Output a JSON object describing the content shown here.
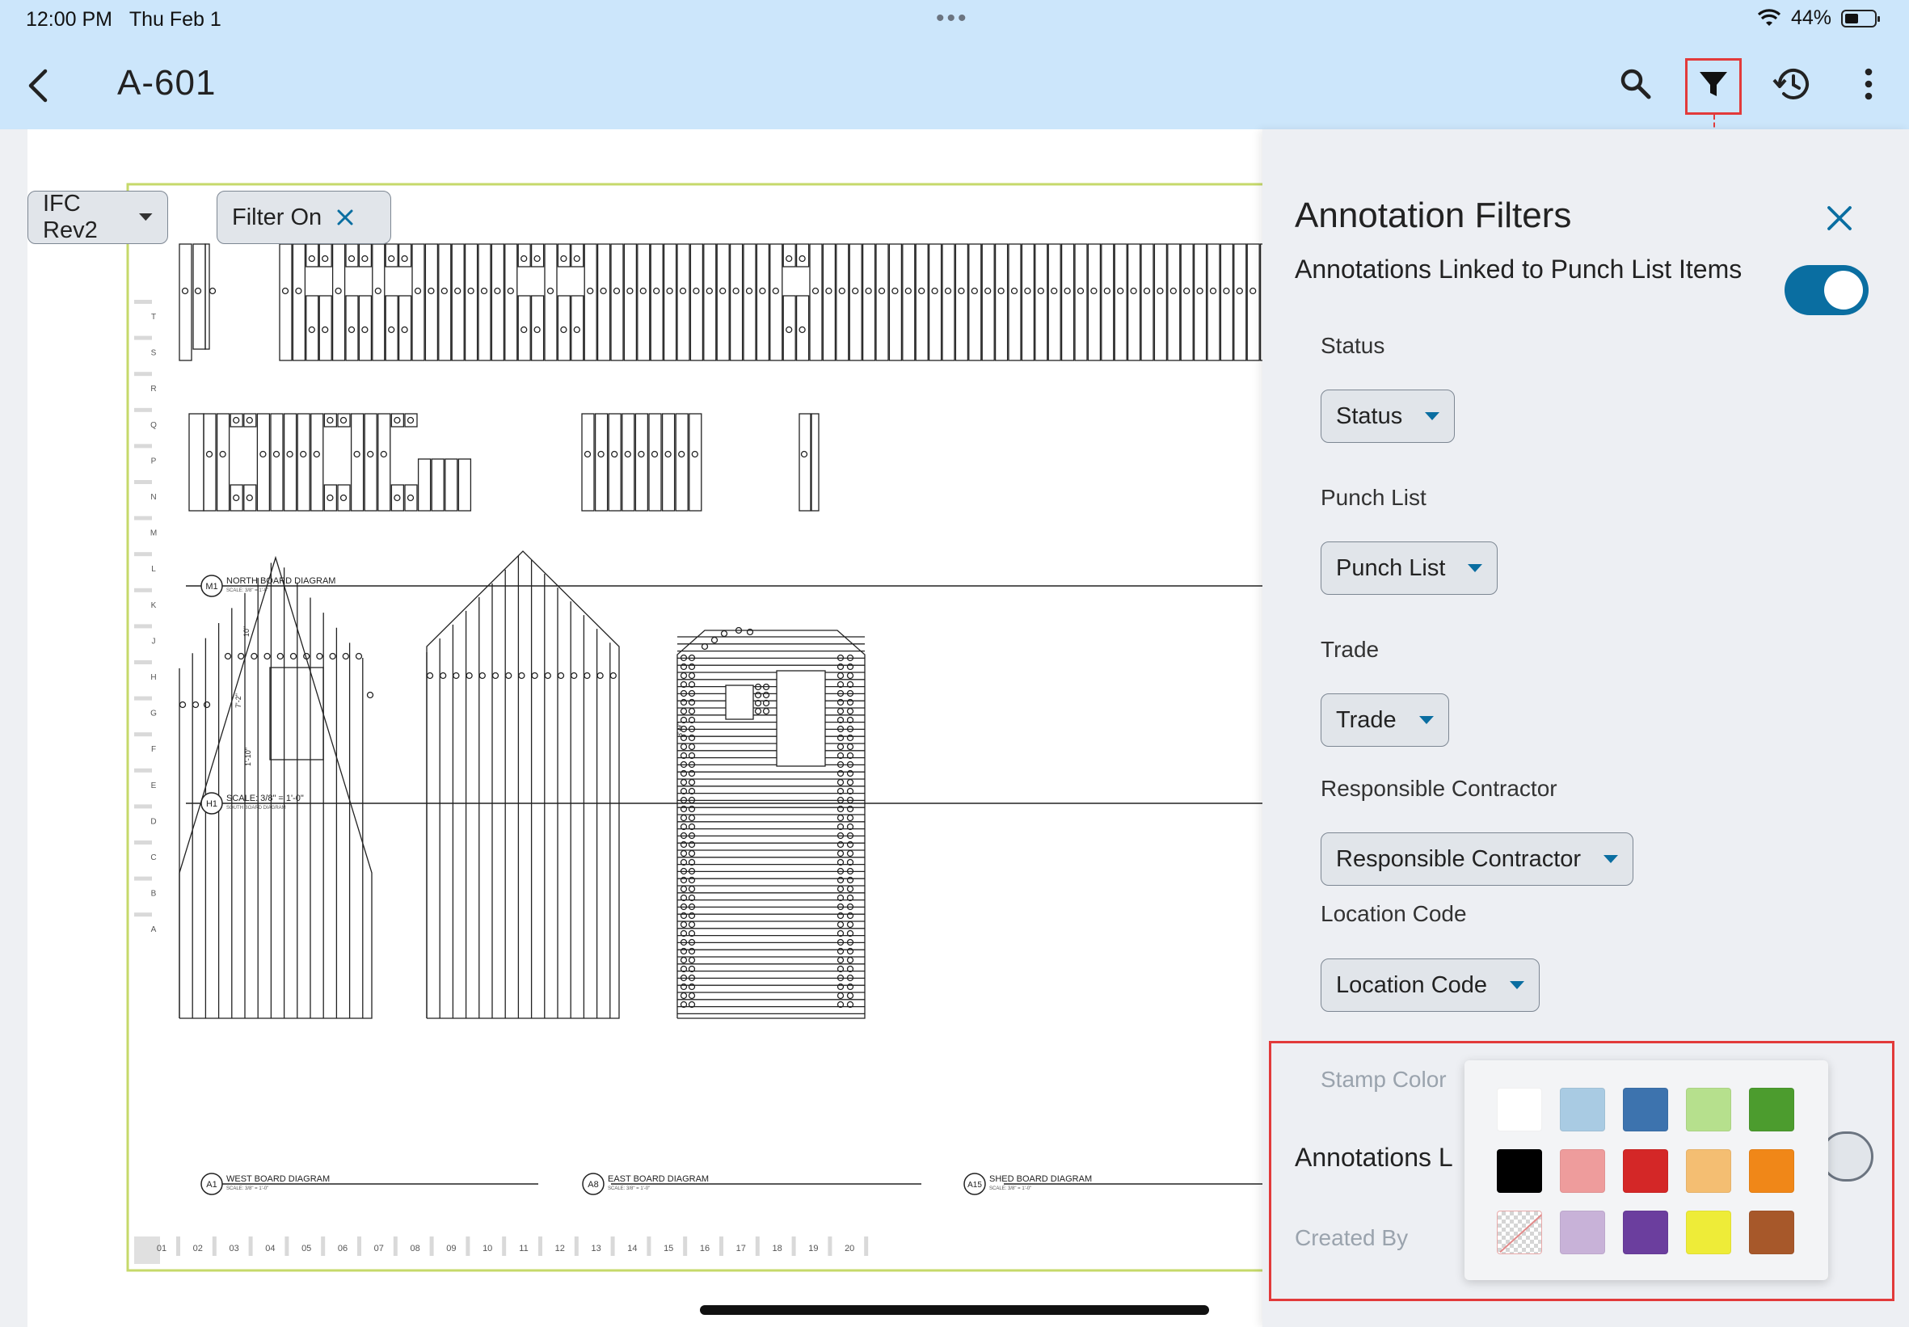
{
  "status_bar": {
    "time": "12:00 PM",
    "date": "Thu Feb 1",
    "dots": "•••",
    "battery": "44%"
  },
  "header": {
    "title": "A-601",
    "icons": [
      "chevron-left-icon",
      "search-icon",
      "filter-icon",
      "history-icon",
      "more-vertical-icon"
    ]
  },
  "toolbar": {
    "revision_chip": "IFC Rev2",
    "filter_chip": "Filter On"
  },
  "drawing": {
    "row_labels": [
      "T",
      "S",
      "R",
      "Q",
      "P",
      "N",
      "M",
      "L",
      "K",
      "J",
      "H",
      "G",
      "F",
      "E",
      "D",
      "C",
      "B",
      "A"
    ],
    "col_labels": [
      "01",
      "02",
      "03",
      "04",
      "05",
      "06",
      "07",
      "08",
      "09",
      "10",
      "11",
      "12",
      "13",
      "14",
      "15",
      "16",
      "17",
      "18",
      "19",
      "20"
    ],
    "north": {
      "tag": "M1",
      "title": "NORTH BOARD DIAGRAM",
      "scale": "SCALE: 3/8\" = 1'-0\""
    },
    "south": {
      "tag": "H1",
      "title": "SCALE: 3/8\" = 1'-0\"",
      "scale": "SOUTH BOARD DIAGRAM"
    },
    "west": {
      "tag": "A1",
      "title": "WEST BOARD DIAGRAM",
      "scale": "SCALE: 3/8\" = 1'-0\""
    },
    "east": {
      "tag": "A8",
      "title": "EAST BOARD DIAGRAM",
      "scale": "SCALE: 3/8\" = 1'-0\""
    },
    "shed": {
      "tag": "A15",
      "title": "SHED BOARD DIAGRAM",
      "scale": "SCALE: 3/8\" = 1'-0\""
    },
    "dims": {
      "d1": "10\"",
      "d2": "7'-2\"",
      "d3": "1'-10\"",
      "d4": "3'-9\""
    }
  },
  "panel": {
    "title": "Annotation Filters",
    "linked_toggle_label": "Annotations Linked to Punch List Items",
    "linked_toggle_on": true,
    "filters": [
      {
        "label": "Status",
        "value": "Status"
      },
      {
        "label": "Punch List",
        "value": "Punch List"
      },
      {
        "label": "Trade",
        "value": "Trade"
      },
      {
        "label": "Responsible Contractor",
        "value": "Responsible Contractor"
      },
      {
        "label": "Location Code",
        "value": "Location Code"
      }
    ],
    "stamp_color_label": "Stamp Color",
    "annotations_partial_label": "Annotations L",
    "created_by_label": "Created By",
    "colors": {
      "accent": "#0a6ea1",
      "header_bg": "#cce6fb",
      "highlight": "#e23a3a",
      "swatches": [
        "#ffffff",
        "#a9cbe3",
        "#3d73ae",
        "#b6e08d",
        "#4c9c2e",
        "#000000",
        "#ee9c9c",
        "#d42727",
        "#f4be72",
        "#f08718",
        "transparent",
        "#c8b2d8",
        "#6b3e9e",
        "#eeec38",
        "#a7582a"
      ]
    }
  }
}
